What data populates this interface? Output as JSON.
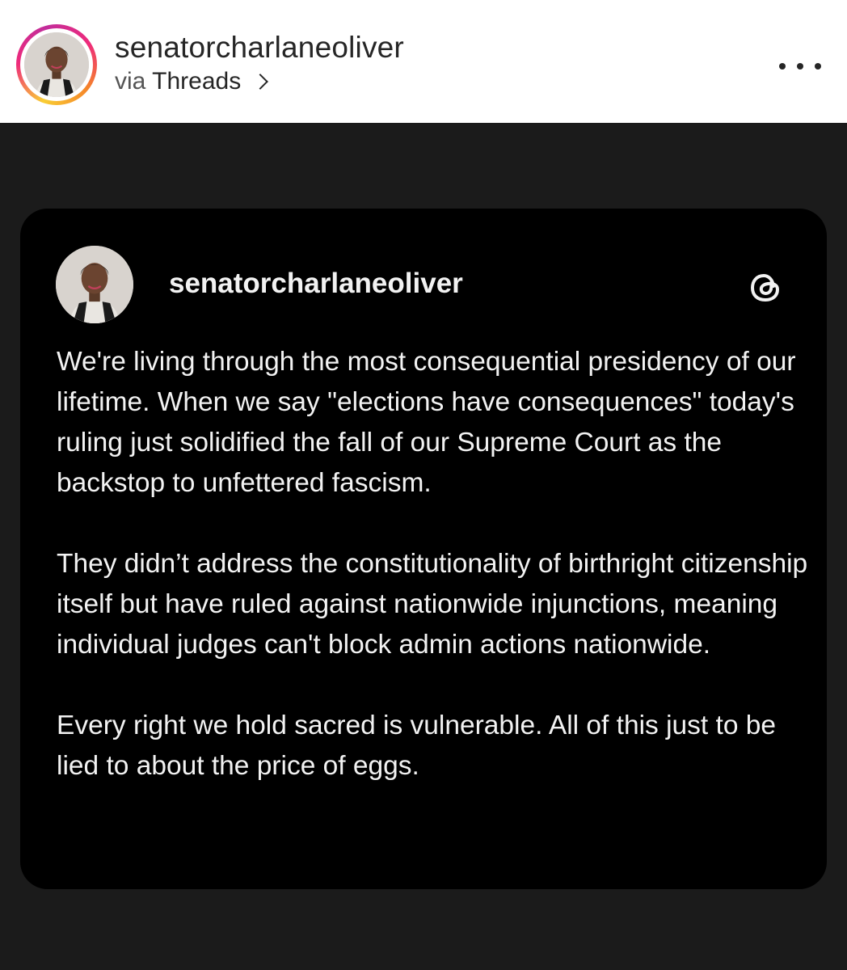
{
  "header": {
    "username": "senatorcharlaneoliver",
    "via_prefix": "via",
    "via_app": "Threads",
    "more_icon": "more-horizontal-icon"
  },
  "post": {
    "username": "senatorcharlaneoliver",
    "app_icon": "threads-logo-icon",
    "paragraphs": [
      "We're living through the most consequential presidency of our lifetime. When we say \"elections have consequences\" today's ruling just solidified the fall of our Supreme Court as the backstop to unfettered fascism.",
      "They didn’t address the constitutionality of birthright citizenship itself but have ruled against nationwide injunctions, meaning individual judges can't block admin actions nationwide.",
      "Every right we hold sacred is vulnerable. All of this just to be lied to about the price of eggs."
    ]
  },
  "colors": {
    "page_background": "#1b1b1b",
    "card_background": "#000000",
    "header_background": "#ffffff",
    "text_light": "#f2f2f2",
    "text_dark": "#262626"
  }
}
